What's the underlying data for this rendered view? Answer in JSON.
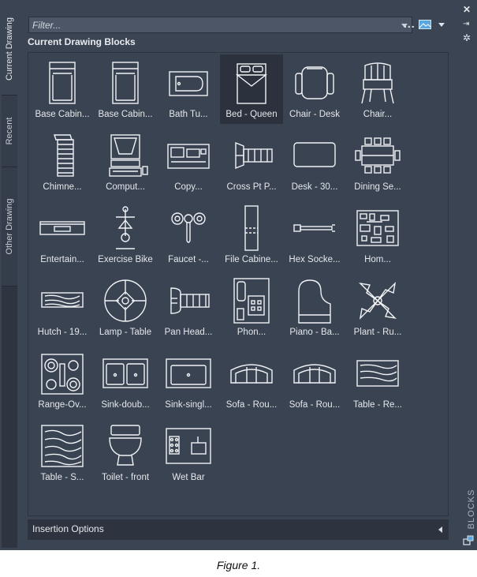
{
  "side_tabs": [
    "Current Drawing",
    "Recent",
    "Other Drawing"
  ],
  "filter": {
    "placeholder": "Filter..."
  },
  "toolbar": {
    "more": "..."
  },
  "section_title": "Current Drawing Blocks",
  "blocks": [
    {
      "label": "Base Cabin...",
      "icon": "base-cabinet-icon"
    },
    {
      "label": "Base Cabin...",
      "icon": "base-cabinet-icon"
    },
    {
      "label": "Bath Tu...",
      "icon": "bathtub-icon"
    },
    {
      "label": "Bed - Queen",
      "icon": "bed-icon",
      "selected": true
    },
    {
      "label": "Chair - Desk",
      "icon": "desk-chair-icon"
    },
    {
      "label": "Chair...",
      "icon": "chair-icon"
    },
    {
      "label": "Chimne...",
      "icon": "chimney-icon"
    },
    {
      "label": "Comput...",
      "icon": "computer-icon"
    },
    {
      "label": "Copy...",
      "icon": "copier-icon"
    },
    {
      "label": "Cross Pt P...",
      "icon": "screw-icon"
    },
    {
      "label": "Desk - 30...",
      "icon": "desk-icon"
    },
    {
      "label": "Dining Se...",
      "icon": "dining-set-icon"
    },
    {
      "label": "Entertain...",
      "icon": "entertainment-center-icon"
    },
    {
      "label": "Exercise Bike",
      "icon": "exercise-bike-icon"
    },
    {
      "label": "Faucet -...",
      "icon": "faucet-icon"
    },
    {
      "label": "File Cabine...",
      "icon": "file-cabinet-icon"
    },
    {
      "label": "Hex Socke...",
      "icon": "hex-socket-icon"
    },
    {
      "label": "Hom...",
      "icon": "circuit-board-icon"
    },
    {
      "label": "Hutch - 19...",
      "icon": "hutch-icon"
    },
    {
      "label": "Lamp - Table",
      "icon": "lamp-icon"
    },
    {
      "label": "Pan Head...",
      "icon": "pan-head-screw-icon"
    },
    {
      "label": "Phon...",
      "icon": "phone-icon"
    },
    {
      "label": "Piano - Ba...",
      "icon": "piano-icon"
    },
    {
      "label": "Plant - Ru...",
      "icon": "plant-icon"
    },
    {
      "label": "Range-Ov...",
      "icon": "range-oven-icon"
    },
    {
      "label": "Sink-doub...",
      "icon": "double-sink-icon"
    },
    {
      "label": "Sink-singl...",
      "icon": "single-sink-icon"
    },
    {
      "label": "Sofa - Rou...",
      "icon": "sofa-icon"
    },
    {
      "label": "Sofa - Rou...",
      "icon": "sofa-icon"
    },
    {
      "label": "Table - Re...",
      "icon": "table-icon"
    },
    {
      "label": "Table - S...",
      "icon": "table-wood-icon"
    },
    {
      "label": "Toilet - front",
      "icon": "toilet-icon"
    },
    {
      "label": "Wet Bar",
      "icon": "wet-bar-icon"
    }
  ],
  "insertion_options": "Insertion Options",
  "palette_label": "BLOCKS",
  "caption": "Figure 1."
}
